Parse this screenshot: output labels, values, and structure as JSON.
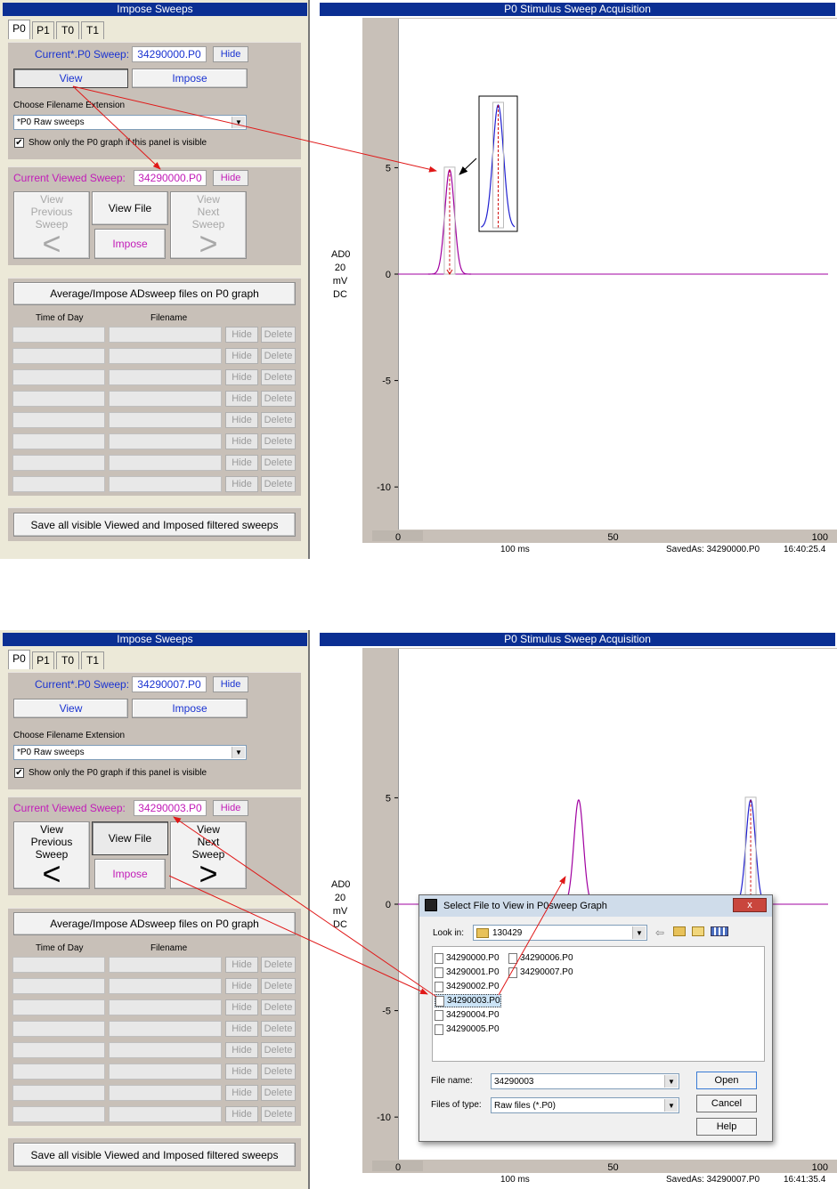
{
  "panels": [
    {
      "left_title": "Impose Sweeps",
      "tabs": [
        "P0",
        "P1",
        "T0",
        "T1"
      ],
      "current_label": "Current*.P0 Sweep:",
      "current_value": "34290000.P0",
      "hide": "Hide",
      "view": "View",
      "impose": "Impose",
      "choose_ext_label": "Choose Filename Extension",
      "ext_selected": "*P0    Raw sweeps",
      "show_only_label": "Show only the P0 graph if this panel is visible",
      "show_only_checked": true,
      "viewed_label": "Current Viewed Sweep:",
      "viewed_value": "34290000.P0",
      "view_prev": "View Previous Sweep",
      "view_file": "View File",
      "view_next": "View Next Sweep",
      "impose2": "Impose",
      "avg_button": "Average/Impose ADsweep files on P0 graph",
      "col_time": "Time of Day",
      "col_file": "Filename",
      "delete": "Delete",
      "save_all": "Save all visible Viewed and Imposed filtered sweeps",
      "right_title": "P0 Stimulus Sweep Acquisition",
      "channel": [
        "AD0",
        "20",
        "mV",
        "DC"
      ],
      "time_scale": "100 ms",
      "saved_as": "SavedAs: 34290000.P0",
      "clock": "16:40:25.4"
    },
    {
      "left_title": "Impose Sweeps",
      "tabs": [
        "P0",
        "P1",
        "T0",
        "T1"
      ],
      "current_label": "Current*.P0 Sweep:",
      "current_value": "34290007.P0",
      "hide": "Hide",
      "view": "View",
      "impose": "Impose",
      "choose_ext_label": "Choose Filename Extension",
      "ext_selected": "*P0    Raw sweeps",
      "show_only_label": "Show only the P0 graph if this panel is visible",
      "show_only_checked": true,
      "viewed_label": "Current Viewed Sweep:",
      "viewed_value": "34290003.P0",
      "view_prev": "View Previous Sweep",
      "view_file": "View File",
      "view_next": "View Next Sweep",
      "impose2": "Impose",
      "avg_button": "Average/Impose ADsweep files on P0 graph",
      "col_time": "Time of Day",
      "col_file": "Filename",
      "delete": "Delete",
      "save_all": "Save all visible Viewed and Imposed filtered sweeps",
      "right_title": "P0 Stimulus Sweep Acquisition",
      "channel": [
        "AD0",
        "20",
        "mV",
        "DC"
      ],
      "time_scale": "100 ms",
      "saved_as": "SavedAs: 34290007.P0",
      "clock": "16:41:35.4"
    }
  ],
  "chart_data": [
    {
      "type": "line",
      "xlim": [
        0,
        100
      ],
      "ylim": [
        -12,
        12
      ],
      "x_ticks": [
        "0",
        "50",
        "100"
      ],
      "y_ticks": [
        "5",
        "0",
        "-5",
        "-10"
      ],
      "series": [
        {
          "color": "#a000a0",
          "peaks": [
            {
              "center": 12,
              "amplitude": 4.9
            }
          ]
        }
      ],
      "inset_color": "#2020d0",
      "colors": {
        "viewed": "#a000a0",
        "imposed": "#2020d0",
        "marker": "#d01010"
      }
    },
    {
      "type": "line",
      "xlim": [
        0,
        100
      ],
      "ylim": [
        -12,
        12
      ],
      "x_ticks": [
        "0",
        "50",
        "100"
      ],
      "y_ticks": [
        "5",
        "0",
        "-5",
        "-10"
      ],
      "series": [
        {
          "color": "#a000a0",
          "peaks": [
            {
              "center": 42,
              "amplitude": 4.9
            }
          ]
        },
        {
          "color": "#2020d0",
          "peaks": [
            {
              "center": 82,
              "amplitude": 4.9
            }
          ]
        }
      ],
      "colors": {
        "viewed": "#a000a0",
        "imposed": "#2020d0",
        "marker": "#d01010"
      }
    }
  ],
  "dialog": {
    "title": "Select File to View in P0sweep Graph",
    "look_in_label": "Look in:",
    "look_in_value": "130429",
    "files": [
      "34290000.P0",
      "34290001.P0",
      "34290002.P0",
      "34290003.P0",
      "34290004.P0",
      "34290005.P0",
      "34290006.P0",
      "34290007.P0"
    ],
    "selected_file": "34290003.P0",
    "file_name_label": "File name:",
    "file_name_value": "34290003",
    "files_of_type_label": "Files of type:",
    "files_of_type_value": "Raw files    (*.P0)",
    "open": "Open",
    "cancel": "Cancel",
    "help": "Help",
    "close": "x"
  }
}
